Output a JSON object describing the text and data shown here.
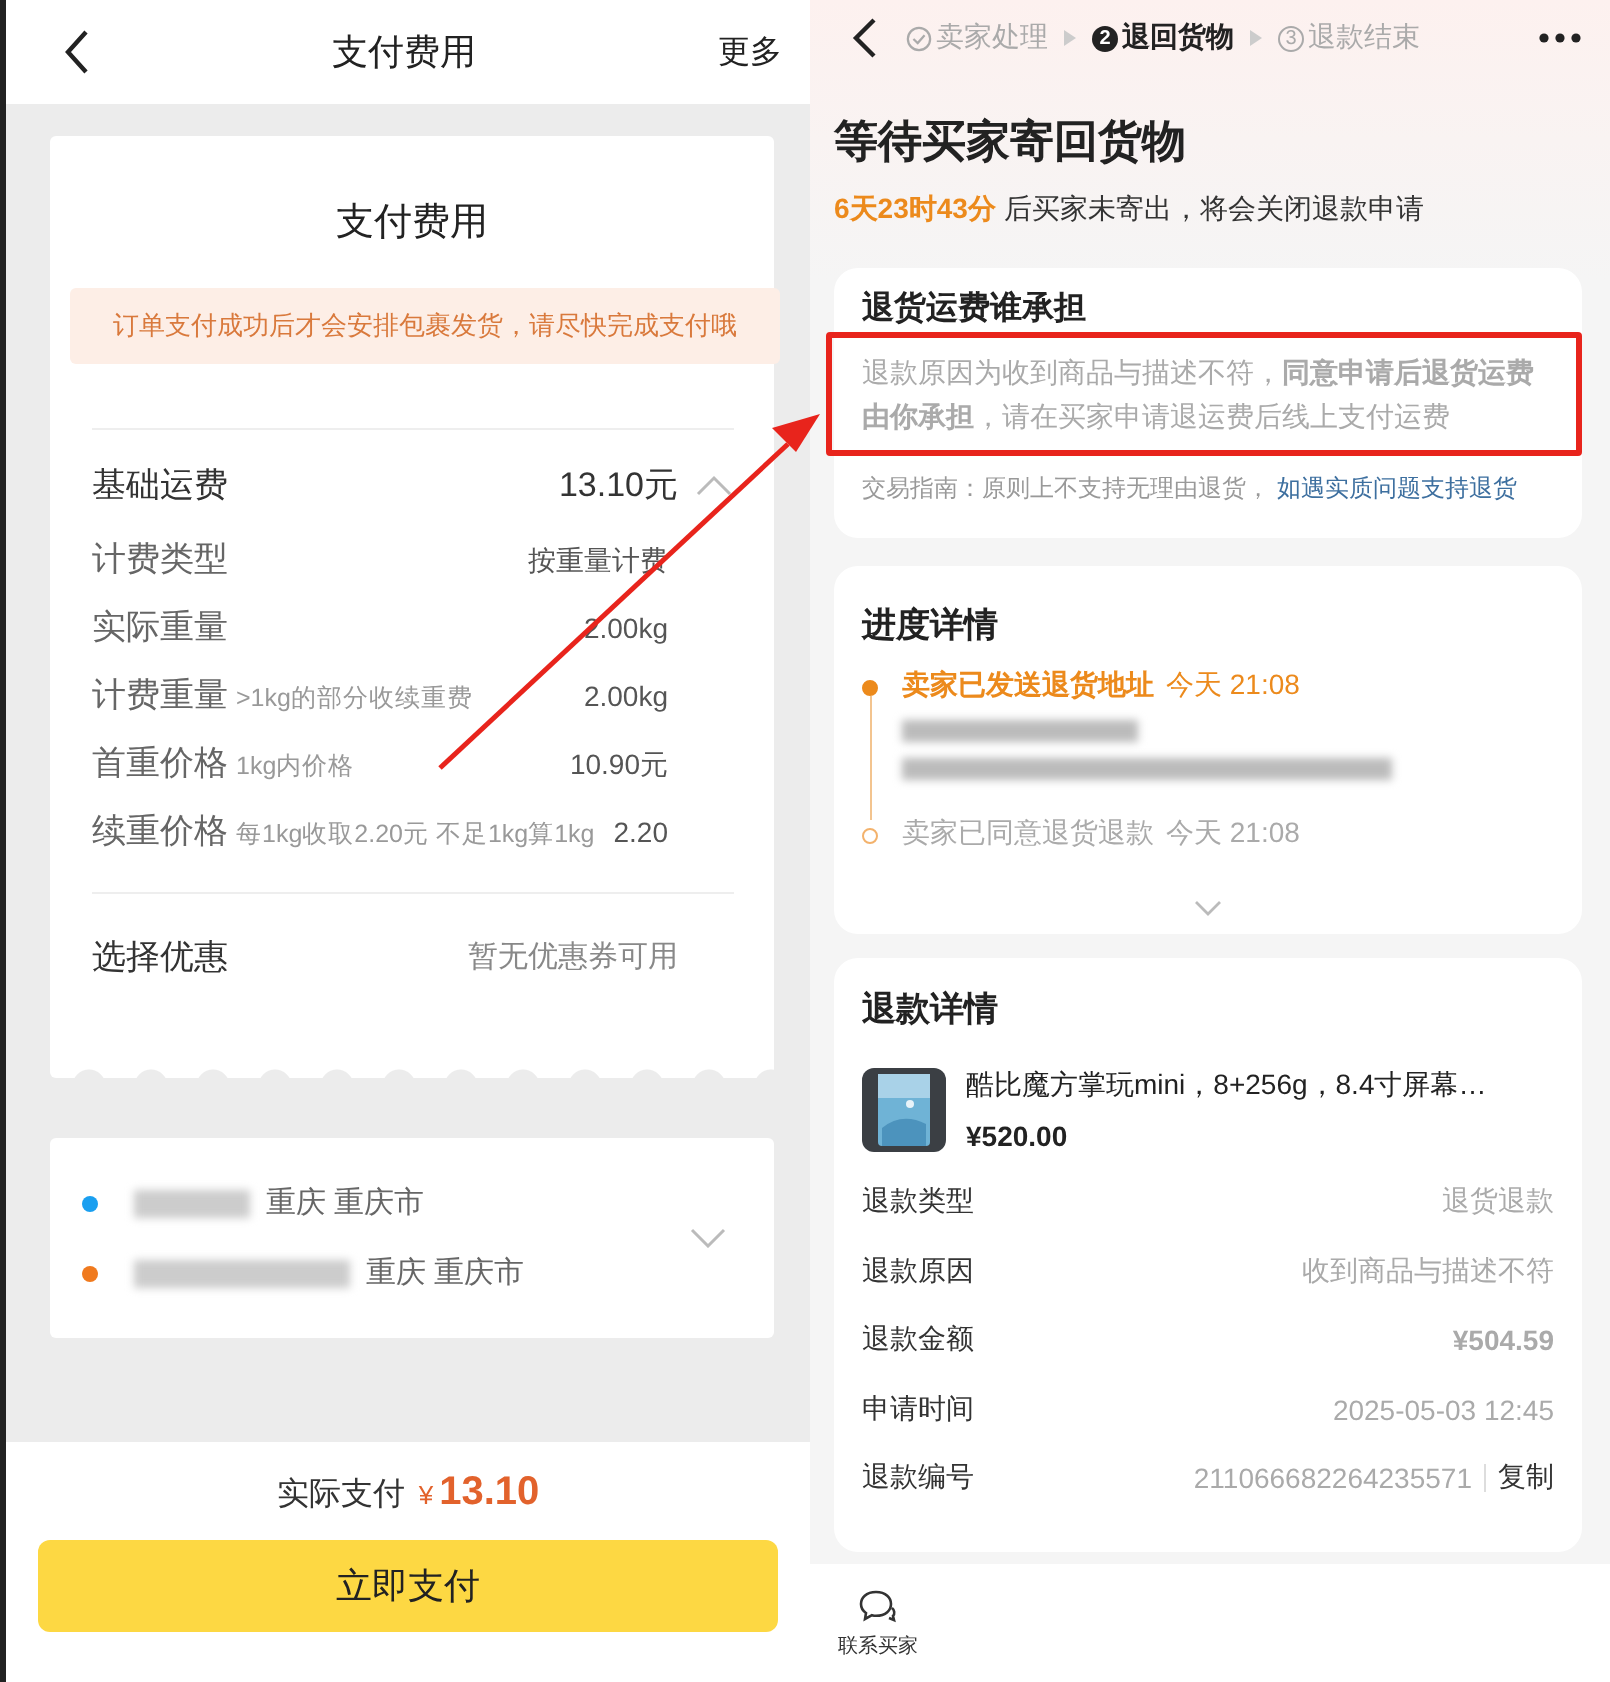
{
  "left": {
    "header": {
      "title": "支付费用",
      "more": "更多"
    },
    "fee_card": {
      "title": "支付费用",
      "notice": "订单支付成功后才会安排包裹发货，请尽快完成支付哦",
      "base_fee": {
        "label": "基础运费",
        "value": "13.10元",
        "expanded": true
      },
      "rows": [
        {
          "label": "计费类型",
          "value": "按重量计费"
        },
        {
          "label": "实际重量",
          "value": "2.00kg"
        },
        {
          "label": "计费重量",
          "hint": ">1kg的部分收续重费",
          "value": "2.00kg"
        },
        {
          "label": "首重价格",
          "hint": "1kg内价格",
          "value": "10.90元"
        },
        {
          "label": "续重价格",
          "hint": "每1kg收取2.20元 不足1kg算1kg",
          "value": "2.20"
        }
      ],
      "coupon": {
        "label": "选择优惠",
        "value": "暂无优惠券可用"
      }
    },
    "route": {
      "stops": [
        {
          "place": "重庆 重庆市",
          "color": "#1a9ff0"
        },
        {
          "place": "重庆 重庆市",
          "color": "#f07a1e"
        }
      ],
      "expanded": false
    },
    "footer": {
      "total_label": "实际支付",
      "currency": "¥",
      "amount": "13.10",
      "pay_button": "立即支付"
    }
  },
  "right": {
    "steps": [
      {
        "label": "卖家处理",
        "done": true,
        "selected": false
      },
      {
        "label": "退回货物",
        "number": "2",
        "done": false,
        "selected": true
      },
      {
        "label": "退款结束",
        "number": "3",
        "done": false,
        "selected": false
      }
    ],
    "title": "等待买家寄回货物",
    "countdown": {
      "time": "6天23时43分",
      "text": "后买家未寄出，将会关闭退款申请"
    },
    "shipping_card": {
      "title": "退货运费谁承担",
      "message": "退款原因为收到商品与描述不符，**同意申请后退货运费由你承担**，请在买家申请退运费后线上支付运费",
      "guide": "交易指南：原则上不支持无理由退货，",
      "guide_link": "如遇实质问题支持退货"
    },
    "progress": {
      "title": "进度详情",
      "events": [
        {
          "title": "卖家已发送退货地址",
          "time": "今天 21:08",
          "active": true
        },
        {
          "title": "卖家已同意退货退款",
          "time": "今天 21:08",
          "active": false
        }
      ]
    },
    "refund": {
      "title": "退款详情",
      "product": {
        "name": "酷比魔方掌玩mini，8+256g，8.4寸屏幕…",
        "price": "¥520.00",
        "kind": "picture"
      },
      "rows": [
        {
          "label": "退款类型",
          "value": "退货退款",
          "kind": "plain"
        },
        {
          "label": "退款原因",
          "value": "收到商品与描述不符",
          "kind": "plain"
        },
        {
          "label": "退款金额",
          "value": "¥504.59",
          "kind": "amount"
        },
        {
          "label": "申请时间",
          "value": "2025-05-03 12:45",
          "kind": "plain"
        },
        {
          "label": "退款编号",
          "value": "211066682264235571",
          "kind": "copyable",
          "action": "复制"
        }
      ]
    },
    "bottom_bar": {
      "contact": "联系买家"
    }
  }
}
